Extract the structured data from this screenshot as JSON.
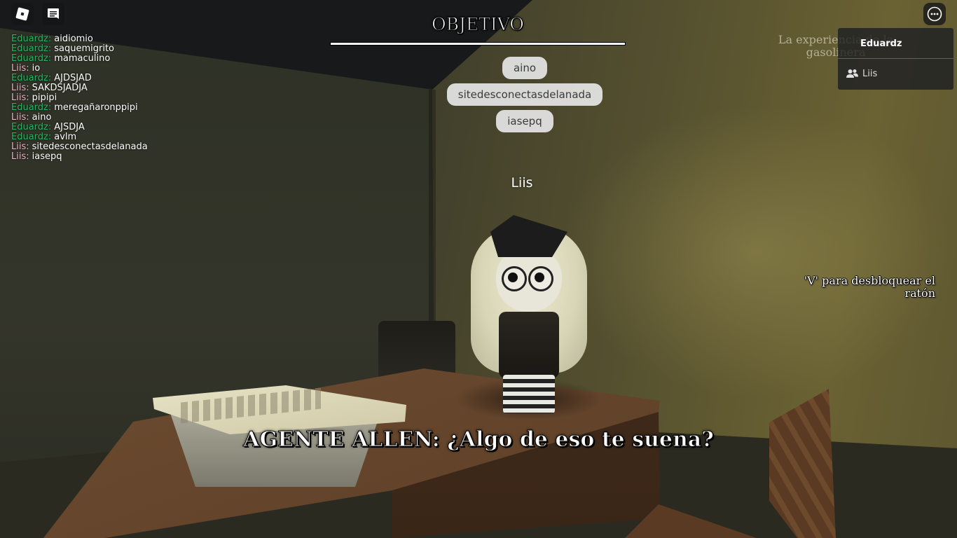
{
  "top_bar": {
    "roblox_icon": "roblox-logo-icon",
    "chat_icon": "chat-icon",
    "menu_icon": "more-options-icon"
  },
  "chat": {
    "messages": [
      {
        "author": "Eduardz:",
        "text": "aidiomio",
        "color": "#2ab561"
      },
      {
        "author": "Eduardz:",
        "text": "saquemigrito",
        "color": "#2ab561"
      },
      {
        "author": "Eduardz:",
        "text": "mamaculino",
        "color": "#2ab561"
      },
      {
        "author": "Liis:",
        "text": "io",
        "color": "#e8b4c4"
      },
      {
        "author": "Eduardz:",
        "text": "AJDSJAD",
        "color": "#2ab561"
      },
      {
        "author": "Liis:",
        "text": "SAKDSJADJA",
        "color": "#e8b4c4"
      },
      {
        "author": "Liis:",
        "text": "pipipi",
        "color": "#e8b4c4"
      },
      {
        "author": "Eduardz:",
        "text": "meregañaronppipi",
        "color": "#2ab561"
      },
      {
        "author": "Liis:",
        "text": "aino",
        "color": "#e8b4c4"
      },
      {
        "author": "Eduardz:",
        "text": "AJSDJA",
        "color": "#2ab561"
      },
      {
        "author": "Eduardz:",
        "text": "avlm",
        "color": "#2ab561"
      },
      {
        "author": "Liis:",
        "text": "sitedesconectasdelanada",
        "color": "#e8b4c4"
      },
      {
        "author": "Liis:",
        "text": "iasepq",
        "color": "#e8b4c4"
      }
    ]
  },
  "objective": {
    "title": "OBJETIVO"
  },
  "bubbles": [
    "aino",
    "sitedesconectasdelanada",
    "iasepq"
  ],
  "nametag": "Liis",
  "place_label": "La experiencia de la gasolinera",
  "hint": "'V' para desbloquear el ratón",
  "dialogue": "AGENTE ALLEN: ¿Algo de eso te suena?",
  "player_list": {
    "header": "Eduardz",
    "players": [
      {
        "name": "Liis",
        "icon": "friends-icon"
      }
    ]
  }
}
